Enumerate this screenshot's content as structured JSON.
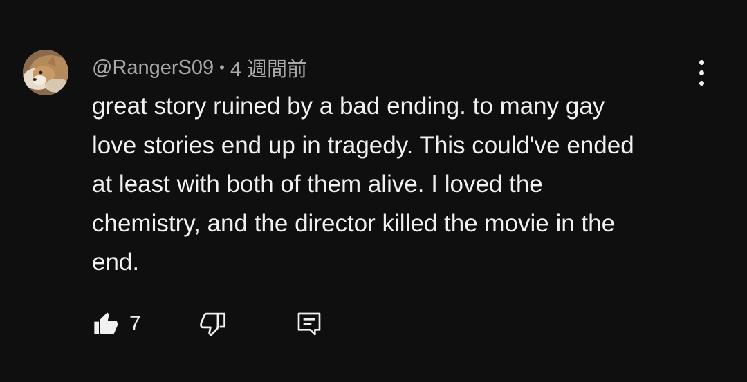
{
  "comment": {
    "author": "@RangerS09",
    "separator": "•",
    "time_ago": "4 週間前",
    "text": "great story ruined by a bad ending. to many gay\nlove stories end up in tragedy. This could've ended\nat least with both of them alive. I loved the\nchemistry, and the director killed the movie in the\nend.",
    "like_count": "7",
    "icons": {
      "avatar": "dog-avatar",
      "menu": "more-vert-icon",
      "like": "thumbs-up-icon",
      "dislike": "thumbs-down-icon",
      "reply": "reply-comment-icon"
    }
  },
  "colors": {
    "background": "#0f0f0f",
    "text": "#f1f1f1",
    "meta": "#aaaaaa"
  }
}
